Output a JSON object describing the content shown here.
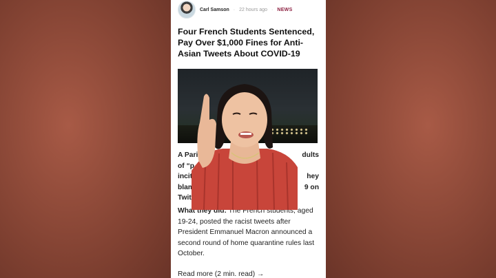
{
  "article": {
    "author": "Carl Samson",
    "separator": "·",
    "time": "22 hours ago",
    "category": "NEWS",
    "headline": "Four French Students Sentenced, Pay Over $1,000 Fines for Anti-Asian Tweets About COVID-19",
    "p1_lines": [
      "A Pari",
      "of “p",
      "incit",
      "blam",
      "Twit"
    ],
    "p1_right_lines": [
      "dults",
      "",
      "hey",
      "9 on",
      ""
    ],
    "p2_lead": "What they did:",
    "p2_rest": " The French students, aged 19-24, posted the racist tweets after President Emmanuel Macron announced a second round of home quarantine rules last October.",
    "read_more": "Read more (2 min. read) →"
  },
  "colors": {
    "background": "#8a4a3a",
    "card": "#ffffff",
    "category": "#8b1e3f",
    "shirt": "#c8453a"
  }
}
